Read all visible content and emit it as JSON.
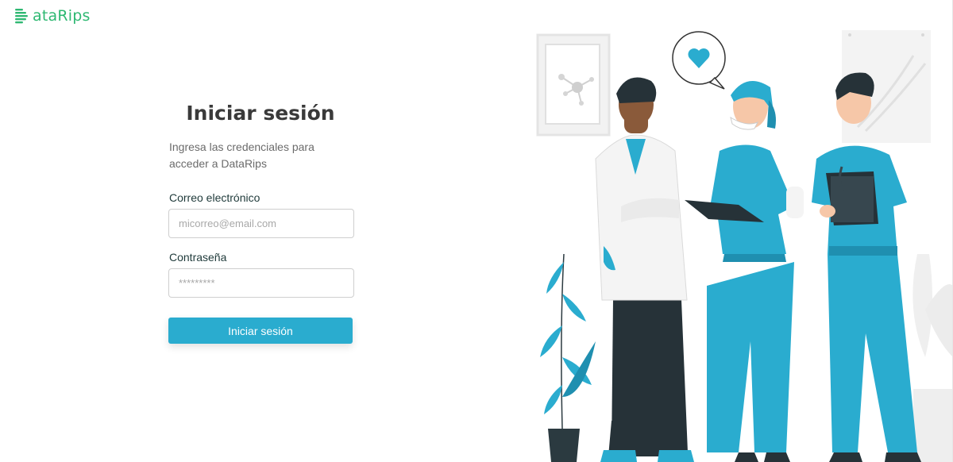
{
  "brand": {
    "logo_text": "ataRips",
    "logo_mark_letter": "D",
    "accent_color": "#2eb872"
  },
  "login": {
    "title": "Iniciar sesión",
    "subtitle": "Ingresa las credenciales para acceder a DataRips",
    "email_label": "Correo electrónico",
    "email_placeholder": "micorreo@email.com",
    "email_value": "",
    "password_label": "Contraseña",
    "password_placeholder": "*********",
    "password_value": "",
    "submit_label": "Iniciar sesión",
    "button_color": "#2aaccf"
  },
  "illustration": {
    "subject": "three-medical-staff-illustration",
    "icons": [
      "heart-speech-bubble-icon",
      "molecule-frame-icon",
      "clipboard-icon",
      "stethoscope-icon",
      "potted-plant-icon"
    ]
  }
}
